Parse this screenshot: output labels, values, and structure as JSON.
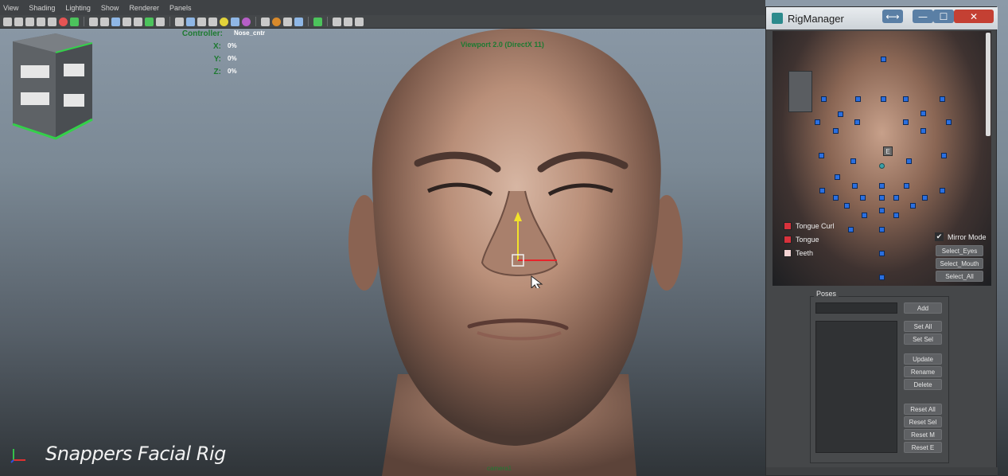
{
  "menu": [
    "View",
    "Shading",
    "Lighting",
    "Show",
    "Renderer",
    "Panels"
  ],
  "hud": {
    "controller_label": "Controller:",
    "controller_value": "Nose_cntr",
    "x_label": "X:",
    "x_value": "0%",
    "y_label": "Y:",
    "y_value": "0%",
    "z_label": "Z:",
    "z_value": "0%"
  },
  "viewport_title": "Viewport 2.0 (DirectX 11)",
  "camera_label": "camera1",
  "watermark": "Snappers Facial Rig",
  "rigmanager": {
    "title": "RigManager",
    "window_buttons": {
      "move": "⟷",
      "minimize": "—",
      "maximize": "☐",
      "close": "✕"
    },
    "e_marker": "E",
    "swatches": [
      {
        "label": "Tongue Curl",
        "color": "#d8323c"
      },
      {
        "label": "Tongue",
        "color": "#d8323c"
      },
      {
        "label": "Teeth",
        "color": "#f4d4d4"
      }
    ],
    "mirror_mode": "Mirror Mode",
    "mirror_checked": "✔",
    "select_buttons": [
      "Select_Eyes",
      "Select_Mouth",
      "Select_All"
    ],
    "poses_label": "Poses",
    "buttons": {
      "add": "Add",
      "set_all": "Set All",
      "set_sel": "Set Sel",
      "update": "Update",
      "rename": "Rename",
      "delete": "Delete",
      "reset_all": "Reset All",
      "reset_sel": "Reset Sel",
      "reset_m": "Reset M",
      "reset_e": "Reset E"
    }
  },
  "colors": {
    "hud_green": "#1d7a30",
    "control_blue": "#2a6fe0",
    "manipulator_yellow": "#f2e22a",
    "manipulator_red": "#e8232a",
    "close_red": "#c44033"
  },
  "icons": [
    "axis-gizmo-icon",
    "snappers-logo-icon",
    "translate-manipulator-icon",
    "mouse-cursor-icon"
  ]
}
